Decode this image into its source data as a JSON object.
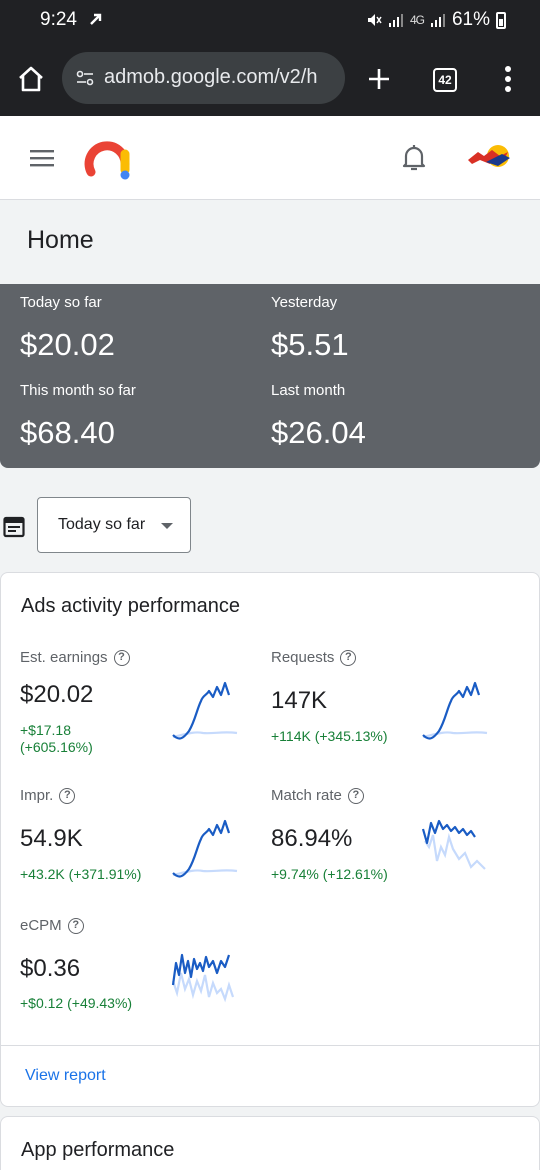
{
  "status_bar": {
    "time": "9:24",
    "network": "4G",
    "battery": "61%"
  },
  "browser": {
    "url": "admob.google.com/v2/h",
    "tab_count": "42"
  },
  "page": {
    "title": "Home"
  },
  "earnings": [
    {
      "label": "Today so far",
      "value": "$20.02"
    },
    {
      "label": "Yesterday",
      "value": "$5.51"
    },
    {
      "label": "This month so far",
      "value": "$68.40"
    },
    {
      "label": "Last month",
      "value": "$26.04"
    }
  ],
  "date_selector": {
    "selected": "Today so far"
  },
  "activity": {
    "title": "Ads activity performance",
    "metrics": [
      {
        "label": "Est. earnings",
        "value": "$20.02",
        "change": "+$17.18\n(+605.16%)",
        "spark": "rise"
      },
      {
        "label": "Requests",
        "value": "147K",
        "change": "+114K (+345.13%)",
        "spark": "rise"
      },
      {
        "label": "Impr.",
        "value": "54.9K",
        "change": "+43.2K (+371.91%)",
        "spark": "rise"
      },
      {
        "label": "Match rate",
        "value": "86.94%",
        "change": "+9.74% (+12.61%)",
        "spark": "fall"
      },
      {
        "label": "eCPM",
        "value": "$0.36",
        "change": "+$0.12 (+49.43%)",
        "spark": "noisy"
      }
    ],
    "view_report": "View report"
  },
  "app_performance": {
    "title": "App performance"
  },
  "colors": {
    "accent": "#1a73e8",
    "positive": "#188038",
    "panel": "#5f6368",
    "spark_primary": "#1a5cc4",
    "spark_secondary": "#c6dafc"
  }
}
